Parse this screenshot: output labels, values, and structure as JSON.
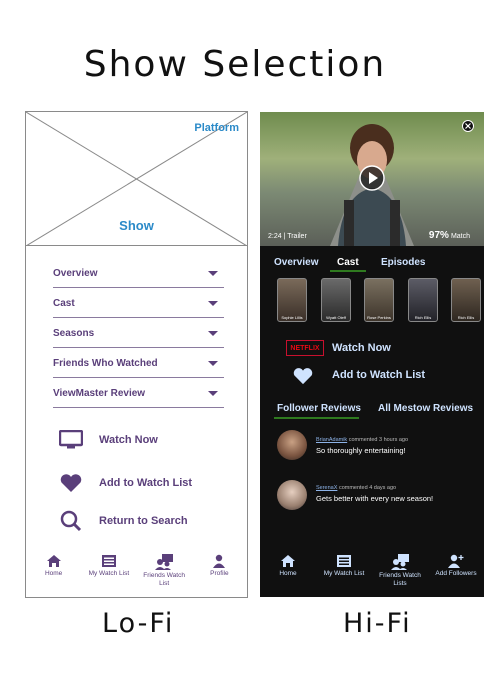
{
  "title": "Show Selection",
  "captions": {
    "lofi": "Lo-Fi",
    "hifi": "Hi-Fi"
  },
  "lofi": {
    "platform": "Platform",
    "show": "Show",
    "accordion": [
      "Overview",
      "Cast",
      "Seasons",
      "Friends Who Watched",
      "ViewMaster Review"
    ],
    "actions": {
      "watch": "Watch Now",
      "add": "Add to Watch List",
      "search": "Return to Search"
    },
    "nav": {
      "home": "Home",
      "list": "My Watch List",
      "friends": "Friends Watch List",
      "profile": "Profile"
    }
  },
  "hifi": {
    "time": "2:24 | Trailer",
    "match_pct": "97%",
    "match_label": "Match",
    "tabs": [
      "Overview",
      "Cast",
      "Episodes"
    ],
    "active_tab": "Cast",
    "cast": [
      "Sophie Lillis",
      "Wyatt Oleff",
      "Rose Perkins",
      "Rich Ellis",
      "Rich Ellis"
    ],
    "netflix": "NETFLIX",
    "watch_now": "Watch Now",
    "add_to_list": "Add to Watch List",
    "reviews_tabs": [
      "Follower Reviews",
      "All Mestow Reviews"
    ],
    "reviews": [
      {
        "user": "BrianAdamik",
        "meta": "commented 3 hours ago",
        "text": "So thoroughly entertaining!"
      },
      {
        "user": "SerenaX",
        "meta": "commented 4 days ago",
        "text": "Gets better with every new season!"
      }
    ],
    "nav": {
      "home": "Home",
      "list": "My Watch List",
      "friends": "Friends Watch Lists",
      "add": "Add Followers"
    },
    "accent": "#2f7a1f"
  }
}
